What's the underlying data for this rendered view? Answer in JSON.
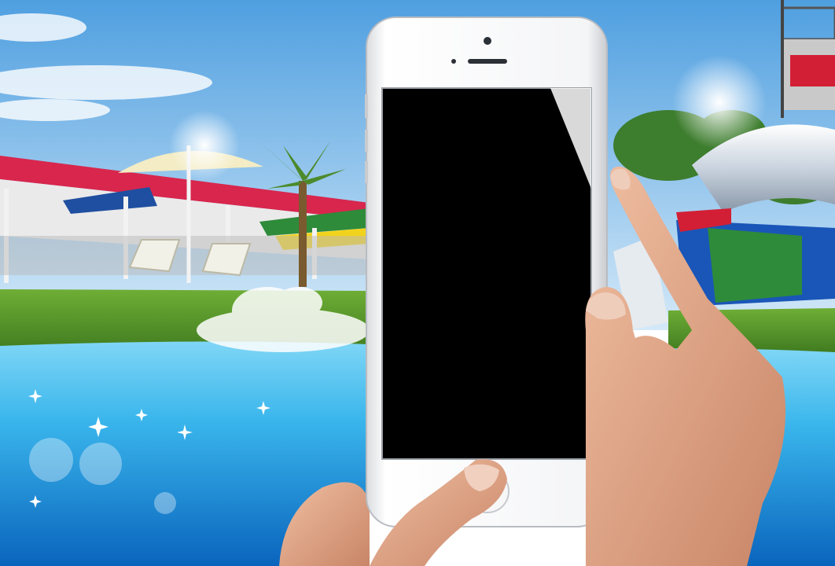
{
  "scene": {
    "description_id": "waterpark-phone-mockup",
    "colors": {
      "sky_top": "#5aa9e6",
      "sky_bottom": "#cfe6f7",
      "grass": "#5f9a2e",
      "water_light": "#5cc8f2",
      "water_deep": "#0a6fc4",
      "phone_body": "#f4f5f7",
      "phone_screen": "#000000",
      "skin": "#e2a888",
      "canopy_red": "#d8264d",
      "canopy_blue": "#1f4fa0",
      "slide_green": "#2e8b3a",
      "slide_blue": "#1a56b8"
    },
    "icons": [
      "phone-speaker-icon",
      "phone-camera-icon",
      "home-button-icon"
    ]
  }
}
